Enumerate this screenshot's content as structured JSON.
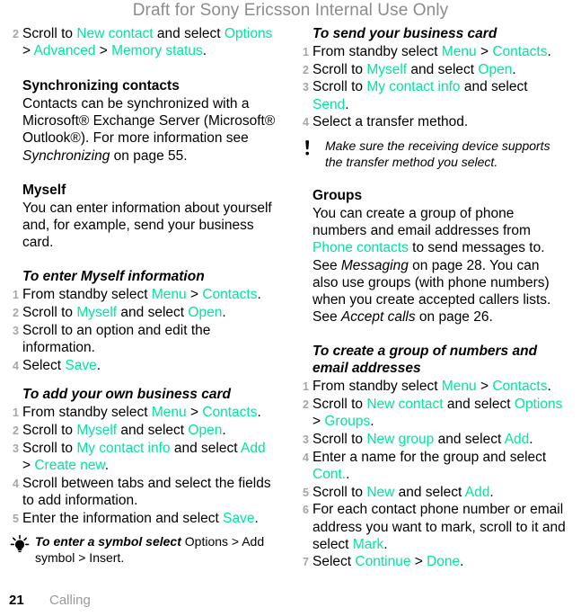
{
  "header": {
    "draft_notice": "Draft for Sony Ericsson Internal Use Only"
  },
  "colors": {
    "accent_ui": "#00e5a0",
    "header_gray": "#8c8c8c",
    "step_number_gray": "#a6a6a6",
    "footer_chapter_gray": "#9a9a9a",
    "body_text": "#000000"
  },
  "left_column": {
    "continued_step": {
      "num": "2",
      "part1": "Scroll to ",
      "ui1": "New contact",
      "part2": " and select ",
      "ui2": "Options",
      "sep1": " > ",
      "ui3": "Advanced",
      "sep2": " > ",
      "ui4": "Memory status",
      "end": "."
    },
    "sync_section": {
      "heading": "Synchronizing contacts",
      "body_part1": "Contacts can be synchronized with a Microsoft® Exchange Server (Microsoft® Outlook®). For more information see ",
      "body_italic": "Synchronizing",
      "body_part2": " on page 55."
    },
    "myself_section": {
      "heading": "Myself",
      "body": "You can enter information about yourself and, for example, send your business card."
    },
    "enter_myself_proc": {
      "title": "To enter Myself information",
      "steps": [
        {
          "num": "1",
          "segments": [
            {
              "t": "From standby select ",
              "s": "plain"
            },
            {
              "t": "Menu",
              "s": "ui"
            },
            {
              "t": " > ",
              "s": "plain"
            },
            {
              "t": "Contacts",
              "s": "ui"
            },
            {
              "t": ".",
              "s": "plain"
            }
          ]
        },
        {
          "num": "2",
          "segments": [
            {
              "t": "Scroll to ",
              "s": "plain"
            },
            {
              "t": "Myself",
              "s": "ui"
            },
            {
              "t": " and select ",
              "s": "plain"
            },
            {
              "t": "Open",
              "s": "ui"
            },
            {
              "t": ".",
              "s": "plain"
            }
          ]
        },
        {
          "num": "3",
          "segments": [
            {
              "t": "Scroll to an option and edit the information.",
              "s": "plain"
            }
          ]
        },
        {
          "num": "4",
          "segments": [
            {
              "t": "Select ",
              "s": "plain"
            },
            {
              "t": "Save",
              "s": "ui"
            },
            {
              "t": ".",
              "s": "plain"
            }
          ]
        }
      ]
    },
    "add_business_card_proc": {
      "title": "To add your own business card",
      "steps": [
        {
          "num": "1",
          "segments": [
            {
              "t": "From standby select ",
              "s": "plain"
            },
            {
              "t": "Menu",
              "s": "ui"
            },
            {
              "t": " > ",
              "s": "plain"
            },
            {
              "t": "Contacts",
              "s": "ui"
            },
            {
              "t": ".",
              "s": "plain"
            }
          ]
        },
        {
          "num": "2",
          "segments": [
            {
              "t": "Scroll to ",
              "s": "plain"
            },
            {
              "t": "Myself",
              "s": "ui"
            },
            {
              "t": " and select ",
              "s": "plain"
            },
            {
              "t": "Open",
              "s": "ui"
            },
            {
              "t": ".",
              "s": "plain"
            }
          ]
        },
        {
          "num": "3",
          "segments": [
            {
              "t": "Scroll to ",
              "s": "plain"
            },
            {
              "t": "My contact info",
              "s": "ui"
            },
            {
              "t": " and select ",
              "s": "plain"
            },
            {
              "t": "Add",
              "s": "ui"
            },
            {
              "t": " > ",
              "s": "plain"
            },
            {
              "t": "Create new",
              "s": "ui"
            },
            {
              "t": ".",
              "s": "plain"
            }
          ]
        },
        {
          "num": "4",
          "segments": [
            {
              "t": "Scroll between tabs and select the fields to add information.",
              "s": "plain"
            }
          ]
        },
        {
          "num": "5",
          "segments": [
            {
              "t": "Enter the information and select ",
              "s": "plain"
            },
            {
              "t": "Save",
              "s": "ui"
            },
            {
              "t": ".",
              "s": "plain"
            }
          ]
        }
      ]
    },
    "tip": {
      "icon": "lightbulb-tip-icon",
      "italic_lead": "To enter a symbol select",
      "rest": " Options > Add symbol > Insert."
    }
  },
  "right_column": {
    "send_business_card_proc": {
      "title": "To send your business card",
      "steps": [
        {
          "num": "1",
          "segments": [
            {
              "t": "From standby select ",
              "s": "plain"
            },
            {
              "t": "Menu",
              "s": "ui"
            },
            {
              "t": " > ",
              "s": "plain"
            },
            {
              "t": "Contacts",
              "s": "ui"
            },
            {
              "t": ".",
              "s": "plain"
            }
          ]
        },
        {
          "num": "2",
          "segments": [
            {
              "t": "Scroll to ",
              "s": "plain"
            },
            {
              "t": "Myself",
              "s": "ui"
            },
            {
              "t": " and select ",
              "s": "plain"
            },
            {
              "t": "Open",
              "s": "ui"
            },
            {
              "t": ".",
              "s": "plain"
            }
          ]
        },
        {
          "num": "3",
          "segments": [
            {
              "t": "Scroll to ",
              "s": "plain"
            },
            {
              "t": "My contact info",
              "s": "ui"
            },
            {
              "t": " and select ",
              "s": "plain"
            },
            {
              "t": "Send",
              "s": "ui"
            },
            {
              "t": ".",
              "s": "plain"
            }
          ]
        },
        {
          "num": "4",
          "segments": [
            {
              "t": "Select a transfer method.",
              "s": "plain"
            }
          ]
        }
      ]
    },
    "note": {
      "icon": "exclamation-note-icon",
      "text": "Make sure the receiving device supports the transfer method you select."
    },
    "groups_section": {
      "heading": "Groups",
      "part1": "You can create a group of phone numbers and email addresses from ",
      "ui1": "Phone contacts",
      "part2": " to send messages to. See ",
      "italic1": "Messaging",
      "part3": " on page 28. You can also use groups (with phone numbers) when you create accepted callers lists. See ",
      "italic2": "Accept calls",
      "part4": " on page 26."
    },
    "create_group_proc": {
      "title": "To create a group of numbers and email addresses",
      "steps": [
        {
          "num": "1",
          "segments": [
            {
              "t": "From standby select ",
              "s": "plain"
            },
            {
              "t": "Menu",
              "s": "ui"
            },
            {
              "t": " > ",
              "s": "plain"
            },
            {
              "t": "Contacts",
              "s": "ui"
            },
            {
              "t": ".",
              "s": "plain"
            }
          ]
        },
        {
          "num": "2",
          "segments": [
            {
              "t": "Scroll to ",
              "s": "plain"
            },
            {
              "t": "New contact",
              "s": "ui"
            },
            {
              "t": " and select ",
              "s": "plain"
            },
            {
              "t": "Options",
              "s": "ui"
            },
            {
              "t": " > ",
              "s": "plain"
            },
            {
              "t": "Groups",
              "s": "ui"
            },
            {
              "t": ".",
              "s": "plain"
            }
          ]
        },
        {
          "num": "3",
          "segments": [
            {
              "t": "Scroll to ",
              "s": "plain"
            },
            {
              "t": "New group",
              "s": "ui"
            },
            {
              "t": " and select ",
              "s": "plain"
            },
            {
              "t": "Add",
              "s": "ui"
            },
            {
              "t": ".",
              "s": "plain"
            }
          ]
        },
        {
          "num": "4",
          "segments": [
            {
              "t": "Enter a name for the group and select ",
              "s": "plain"
            },
            {
              "t": "Cont.",
              "s": "ui"
            },
            {
              "t": ".",
              "s": "plain"
            }
          ]
        },
        {
          "num": "5",
          "segments": [
            {
              "t": "Scroll to ",
              "s": "plain"
            },
            {
              "t": "New",
              "s": "ui"
            },
            {
              "t": " and select ",
              "s": "plain"
            },
            {
              "t": "Add",
              "s": "ui"
            },
            {
              "t": ".",
              "s": "plain"
            }
          ]
        },
        {
          "num": "6",
          "segments": [
            {
              "t": "For each contact phone number or email address you want to mark, scroll to it and select ",
              "s": "plain"
            },
            {
              "t": "Mark",
              "s": "ui"
            },
            {
              "t": ".",
              "s": "plain"
            }
          ]
        },
        {
          "num": "7",
          "segments": [
            {
              "t": "Select ",
              "s": "plain"
            },
            {
              "t": "Continue",
              "s": "ui"
            },
            {
              "t": " > ",
              "s": "plain"
            },
            {
              "t": "Done",
              "s": "ui"
            },
            {
              "t": ".",
              "s": "plain"
            }
          ]
        }
      ]
    }
  },
  "footer": {
    "page_number": "21",
    "chapter": "Calling"
  }
}
